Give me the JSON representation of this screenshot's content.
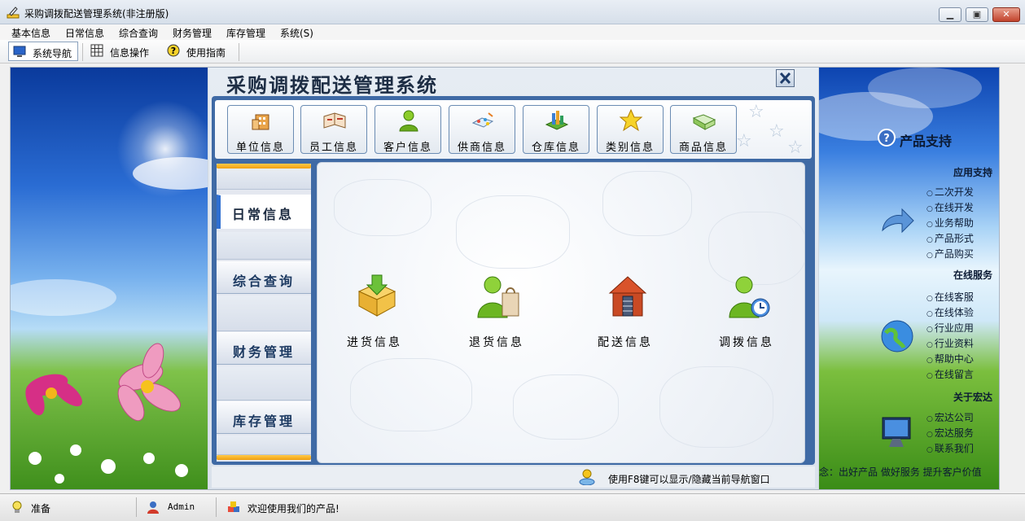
{
  "window": {
    "title": "采购调拨配送管理系统(非注册版)",
    "icon": "pen-edit-icon",
    "controls": [
      "minimize-icon",
      "maximize-icon",
      "close-icon"
    ]
  },
  "menu": [
    "基本信息",
    "日常信息",
    "综合查询",
    "财务管理",
    "库存管理",
    "系统(S)"
  ],
  "toolbar": [
    {
      "label": "系统导航",
      "icon": "monitor-icon",
      "active": true
    },
    {
      "label": "信息操作",
      "icon": "grid-icon",
      "active": false
    },
    {
      "label": "使用指南",
      "icon": "help-icon",
      "active": false
    }
  ],
  "dialog": {
    "title": "采购调拨配送管理系统",
    "categories": [
      {
        "label": "单位信息",
        "icon": "building-icon"
      },
      {
        "label": "员工信息",
        "icon": "notebook-icon"
      },
      {
        "label": "客户信息",
        "icon": "person-icon"
      },
      {
        "label": "供商信息",
        "icon": "supplier-icon"
      },
      {
        "label": "仓库信息",
        "icon": "warehouse-icon"
      },
      {
        "label": "类别信息",
        "icon": "star-icon"
      },
      {
        "label": "商品信息",
        "icon": "book-icon"
      }
    ],
    "nav": [
      {
        "label": "日常信息",
        "active": true
      },
      {
        "label": "综合查询",
        "active": false
      },
      {
        "label": "财务管理",
        "active": false
      },
      {
        "label": "库存管理",
        "active": false
      }
    ],
    "operations": [
      {
        "label": "进货信息",
        "icon": "box-download-icon"
      },
      {
        "label": "退货信息",
        "icon": "person-bag-icon"
      },
      {
        "label": "配送信息",
        "icon": "delivery-house-icon"
      },
      {
        "label": "调拨信息",
        "icon": "person-clock-icon"
      }
    ],
    "hint": "使用F8键可以显示/隐藏当前导航窗口"
  },
  "right_panel": {
    "title": "产品支持",
    "sections": [
      {
        "title": "应用支持",
        "links": [
          "二次开发",
          "在线开发",
          "业务帮助",
          "产品形式",
          "产品购买"
        ]
      },
      {
        "title": "在线服务",
        "links": [
          "在线客服",
          "在线体验",
          "行业应用",
          "行业资料",
          "帮助中心",
          "在线留言"
        ]
      },
      {
        "title": "关于宏达",
        "links": [
          "宏达公司",
          "宏达服务",
          "联系我们"
        ]
      }
    ],
    "slogan": "念：出好产品  做好服务  提升客户价值"
  },
  "status": [
    {
      "text": "准备",
      "icon": "lightbulb-icon"
    },
    {
      "text": "Admin",
      "icon": "user-icon"
    },
    {
      "text": "欢迎使用我们的产品!",
      "icon": "cubes-icon"
    }
  ],
  "colors": {
    "frame": "#3f6aa5",
    "accent": "#2f6fd1",
    "nav_bar": "#f0a010"
  }
}
